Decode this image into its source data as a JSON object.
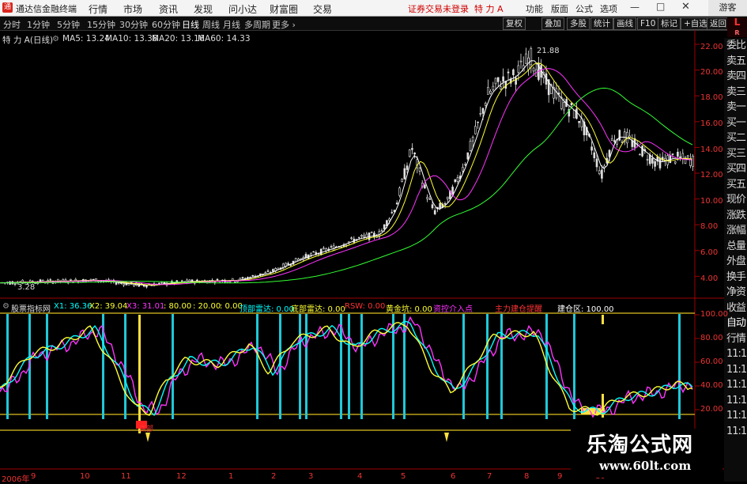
{
  "window": {
    "app_title": "通达信金融终端",
    "menu": [
      "行情",
      "市场",
      "资讯",
      "发现",
      "问小达",
      "财富圈",
      "交易"
    ],
    "warning": "证券交易未登录",
    "stock_tag": "特 力 A",
    "right_menu": [
      "功能",
      "版面",
      "公式",
      "选项"
    ],
    "guest": "游客"
  },
  "toolbar": {
    "periods": [
      "分时",
      "1分钟",
      "5分钟",
      "15分钟",
      "30分钟",
      "60分钟",
      "日线",
      "周线",
      "月线",
      "多周期",
      "更多"
    ],
    "active_period": "日线",
    "right_buttons": [
      "复权",
      "叠加",
      "多股",
      "统计",
      "画线",
      "F10",
      "标记",
      "+自选",
      "返回"
    ]
  },
  "side_panel": {
    "corner": "L",
    "items": [
      "委比",
      "卖五",
      "卖四",
      "卖三",
      "卖一",
      "买一",
      "买二",
      "买三",
      "买四",
      "买五",
      "现价",
      "涨跌",
      "涨幅",
      "总量",
      "外盘",
      "换手",
      "净资",
      "收益",
      "自动",
      "行情",
      "11:1",
      "11:1",
      "11:1",
      "11:1",
      "11:1",
      "11:1"
    ]
  },
  "main_chart": {
    "stock_name": "特 力 A",
    "period_tag": "(日线)",
    "ma": [
      {
        "label": "MA5: 13.24",
        "color": "#ffffff"
      },
      {
        "label": "MA10: 13.38",
        "color": "#ffff33"
      },
      {
        "label": "MA20: 13.16",
        "color": "#ff33ff"
      },
      {
        "label": "MA60: 14.33",
        "color": "#33ff33"
      }
    ],
    "price_ticks": [
      "22.00",
      "20.00",
      "18.00",
      "16.00",
      "14.00",
      "12.00",
      "10.00",
      "8.00",
      "6.00",
      "4.00"
    ],
    "high_marker": "21.88",
    "low_marker": "3.28"
  },
  "indicator": {
    "title": "股票指标网",
    "items": [
      {
        "label": "X1: 36.36",
        "color": "#00ffff"
      },
      {
        "label": "X2: 39.04",
        "color": "#ffff33"
      },
      {
        "label": "X3: 31.01",
        "color": "#ff33ff"
      },
      {
        "label": ": 80.00",
        "color": "#ffff33"
      },
      {
        "label": ": 20.00",
        "color": "#ffff33"
      },
      {
        "label": ": 0.00",
        "color": "#ffff33"
      },
      {
        "label": "顶部雷达: 0.00",
        "color": "#00ffff"
      },
      {
        "label": "底部雷达: 0.00",
        "color": "#ffff33"
      },
      {
        "label": "RSW: 0.00",
        "color": "#ff3333"
      },
      {
        "label": "黄金坑: 0.00",
        "color": "#ffff33"
      },
      {
        "label": "资控介入点",
        "color": "#ff33ff"
      },
      {
        "label": "主力建仓提醒",
        "color": "#ff3333"
      },
      {
        "label": "建仓区: 100.00",
        "color": "#ffffff"
      }
    ],
    "ticks": [
      "100.00",
      "80.00",
      "60.00",
      "40.00",
      "20.00"
    ],
    "signal_label": "底部"
  },
  "x_axis": [
    "2006年",
    "9",
    "10",
    "11",
    "12",
    "1",
    "2",
    "3",
    "4",
    "5",
    "6",
    "7",
    "8",
    "9",
    "10"
  ],
  "watermark": {
    "line1": "乐淘公式网",
    "line2": "www.60lt.com"
  }
}
